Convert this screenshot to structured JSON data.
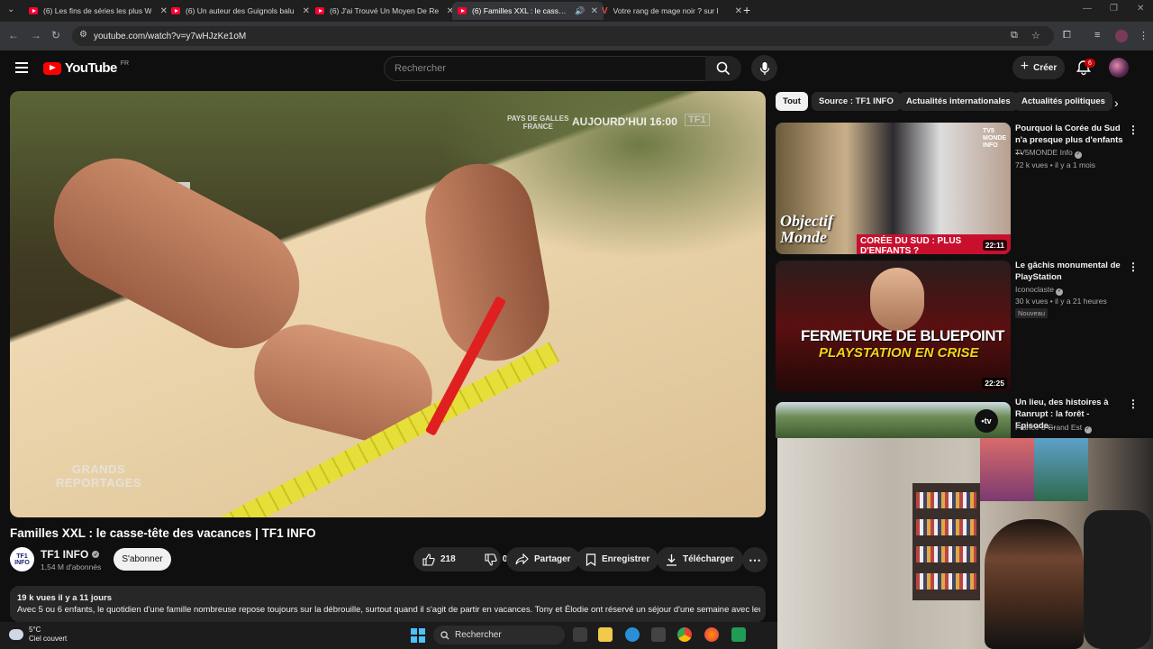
{
  "browser": {
    "tabs": [
      {
        "title": "(6) Les fins de séries les plus W",
        "type": "youtube"
      },
      {
        "title": "(6) Un auteur des Guignols balu",
        "type": "youtube"
      },
      {
        "title": "(6) J'ai Trouvé Un Moyen De Re",
        "type": "youtube"
      },
      {
        "title": "(6) Familles XXL : le casse-tê",
        "type": "youtube",
        "active": true
      },
      {
        "title": "Votre rang de mage noir ? sur l",
        "type": "vinted"
      }
    ],
    "new_tab": "+",
    "url": "youtube.com/watch?v=y7wHJzKe1oM"
  },
  "masthead": {
    "logo_text": "YouTube",
    "country": "FR",
    "search_placeholder": "Rechercher",
    "create_label": "Créer",
    "notification_count": "6"
  },
  "video": {
    "overlay_place": "PAYS DE GALLES\nFRANCE",
    "overlay_time": "AUJOURD'HUI 16:00",
    "overlay_logo": "TF1",
    "watermark": "GRANDS\nREPORTAGES",
    "title": "Familles XXL : le casse-tête des vacances | TF1 INFO",
    "channel_name": "TF1 INFO",
    "channel_avatar": "TF1\nINFO",
    "subscribers": "1,54 M d'abonnés",
    "subscribe_label": "S'abonner",
    "likes": "218",
    "dislikes": "0",
    "share_label": "Partager",
    "save_label": "Enregistrer",
    "download_label": "Télécharger",
    "views_date": "19 k vues  il y a 11 jours",
    "description": "Avec 5 ou 6 enfants, le quotidien d'une famille nombreuse repose toujours sur la débrouille, surtout quand il s'agit de partir en vacances. Tony et Élodie ont réservé un séjour d'une semaine avec leur"
  },
  "chips": [
    "Tout",
    "Source : TF1 INFO",
    "Actualités internationales",
    "Actualités politiques"
  ],
  "recommendations": [
    {
      "title": "Pourquoi la Corée du Sud n'a presque plus d'enfants ...",
      "channel": "TV5MONDE Info",
      "meta": "72 k vues • il y a 1 mois",
      "duration": "22:11",
      "thumb_text_1": "Objectif\nMonde",
      "thumb_text_2": "CORÉE DU SUD : PLUS D'ENFANTS ?",
      "thumb_text_3": "TV5\nMONDE\nINFO"
    },
    {
      "title": "Le gâchis monumental de PlayStation",
      "channel": "Iconoclaste",
      "meta": "30 k vues • il y a 21 heures",
      "badge": "Nouveau",
      "duration": "22:25",
      "thumb_text_1": "FERMETURE DE BLUEPOINT",
      "thumb_text_2": "PLAYSTATION EN CRISE"
    },
    {
      "title": "Un lieu, des histoires à Ranrupt : la forêt - Episode...",
      "channel": "France 3 Grand Est",
      "thumb_badge": "•tv"
    }
  ],
  "taskbar": {
    "temp": "5°C",
    "weather": "Ciel couvert",
    "search_label": "Rechercher"
  },
  "colors": {
    "background": "#0f0f0f",
    "youtube_red": "#ff0000",
    "chip_selected": "#f1f1f1",
    "pill": "#272727"
  }
}
